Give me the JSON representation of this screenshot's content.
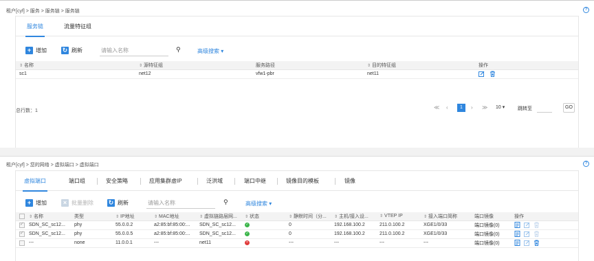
{
  "panel1": {
    "breadcrumb": "租户[cyf] > 服务 > 服务链 > 服务链",
    "tabs": [
      "服务链",
      "流量特征组"
    ],
    "toolbar": {
      "add": "增加",
      "refresh": "刷新",
      "search_placeholder": "请输入名称",
      "advanced": "高级搜索 ▾"
    },
    "columns": [
      "名称",
      "源特征组",
      "服务路径",
      "目的特征组",
      "操作"
    ],
    "rows": [
      {
        "name": "sc1",
        "src": "net12",
        "path": "vfw1-pbr",
        "dst": "net11"
      }
    ],
    "total": "总行数：1",
    "pager": {
      "first": "≪",
      "prev": "‹",
      "page": "1",
      "next": "›",
      "last": "≫",
      "size": "10 ▾",
      "jump": "跳转至",
      "go": "GO"
    }
  },
  "panel2": {
    "breadcrumb": "租户[cyf] > 您的网络 > 虚拟端口 > 虚拟端口",
    "tabs": [
      "虚拟端口",
      "端口组",
      "安全策略",
      "应用集群虚IP",
      "泛洪域",
      "端口中继",
      "镜像目的模板",
      "镜像"
    ],
    "toolbar": {
      "add": "增加",
      "delete": "批量删除",
      "refresh": "刷新",
      "search_placeholder": "请输入名称",
      "advanced": "高级搜索 ▾"
    },
    "columns": [
      "名称",
      "类型",
      "IP地址",
      "MAC地址",
      "虚拟链路层网...",
      "状态",
      "静默时间（分...",
      "主机/接入设...",
      "VTEP IP",
      "接入端口简称",
      "端口镜像",
      "操作"
    ],
    "rows": [
      {
        "checked": true,
        "name": "SDN_SC_sc12...",
        "type": "phy",
        "ip": "55.0.0.2",
        "mac": "a2:85:bf:85:00:...",
        "vnet": "SDN_SC_sc12...",
        "status": "ok",
        "quiet": "0",
        "host": "192.168.100.2",
        "vtep": "211.0.100.2",
        "port": "XGE1/0/33",
        "mirror": "端口镜像(0)"
      },
      {
        "checked": true,
        "name": "SDN_SC_sc12...",
        "type": "phy",
        "ip": "55.0.0.5",
        "mac": "a2:85:bf:85:00:...",
        "vnet": "SDN_SC_sc12...",
        "status": "ok",
        "quiet": "0",
        "host": "192.168.100.2",
        "vtep": "211.0.100.2",
        "port": "XGE1/0/33",
        "mirror": "端口镜像(0)"
      },
      {
        "checked": false,
        "name": "---",
        "type": "none",
        "ip": "11.0.0.1",
        "mac": "---",
        "vnet": "net11",
        "status": "bad",
        "quiet": "---",
        "host": "---",
        "vtep": "---",
        "port": "---",
        "mirror": "端口镜像(0)"
      }
    ]
  },
  "colors": {
    "accent": "#2f86de",
    "ok": "#3bb54a",
    "error": "#e03b3b"
  }
}
